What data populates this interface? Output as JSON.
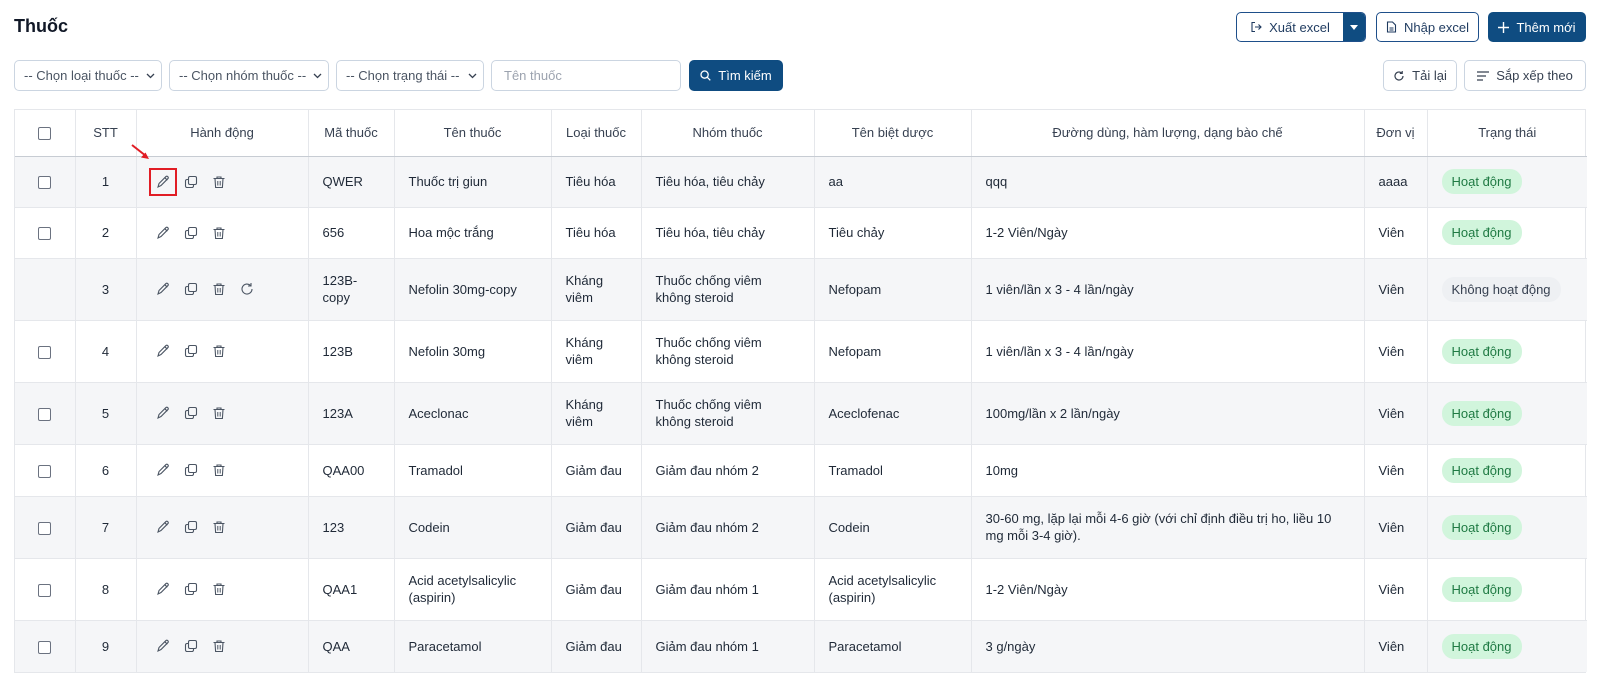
{
  "page": {
    "title": "Thuốc"
  },
  "toolbar": {
    "export_label": "Xuất excel",
    "import_label": "Nhập excel",
    "add_label": "Thêm mới",
    "reload_label": "Tải lại",
    "sort_label": "Sắp xếp theo"
  },
  "filters": {
    "drug_type": "-- Chọn loại thuốc --",
    "drug_group": "-- Chọn nhóm thuốc --",
    "status": "-- Chọn trạng thái --",
    "name_placeholder": "Tên thuốc",
    "search_label": "Tìm kiếm"
  },
  "table": {
    "headers": [
      "STT",
      "Hành động",
      "Mã thuốc",
      "Tên thuốc",
      "Loại thuốc",
      "Nhóm thuốc",
      "Tên biệt dược",
      "Đường dùng, hàm lượng, dạng bào chế",
      "Đơn vị",
      "Trạng thái"
    ],
    "rows": [
      {
        "stt": "1",
        "code": "QWER",
        "name": "Thuốc trị giun",
        "type": "Tiêu hóa",
        "group": "Tiêu hóa, tiêu chảy",
        "brand": "aa",
        "usage": "qqq",
        "unit": "aaaa",
        "status": "Hoạt động"
      },
      {
        "stt": "2",
        "code": "656",
        "name": "Hoa mộc trắng",
        "type": "Tiêu hóa",
        "group": "Tiêu hóa, tiêu chảy",
        "brand": "Tiêu chảy",
        "usage": "1-2 Viên/Ngày",
        "unit": "Viên",
        "status": "Hoạt động"
      },
      {
        "stt": "3",
        "code": "123B-copy",
        "name": "Nefolin 30mg-copy",
        "type": "Kháng viêm",
        "group": "Thuốc chống viêm không steroid",
        "brand": "Nefopam",
        "usage": "1 viên/lần x 3 - 4 lần/ngày",
        "unit": "Viên",
        "status": "Không hoạt động"
      },
      {
        "stt": "4",
        "code": "123B",
        "name": "Nefolin 30mg",
        "type": "Kháng viêm",
        "group": "Thuốc chống viêm không steroid",
        "brand": "Nefopam",
        "usage": "1 viên/lần x 3 - 4 lần/ngày",
        "unit": "Viên",
        "status": "Hoạt động"
      },
      {
        "stt": "5",
        "code": "123A",
        "name": "Aceclonac",
        "type": "Kháng viêm",
        "group": "Thuốc chống viêm không steroid",
        "brand": "Aceclofenac",
        "usage": "100mg/lần x 2 lần/ngày",
        "unit": "Viên",
        "status": "Hoạt động"
      },
      {
        "stt": "6",
        "code": "QAA00",
        "name": "Tramadol",
        "type": "Giảm đau",
        "group": "Giảm đau nhóm 2",
        "brand": "Tramadol",
        "usage": "10mg",
        "unit": "Viên",
        "status": "Hoạt động"
      },
      {
        "stt": "7",
        "code": "123",
        "name": "Codein",
        "type": "Giảm đau",
        "group": "Giảm đau nhóm 2",
        "brand": "Codein",
        "usage": "30-60 mg, lặp lại mỗi 4-6 giờ (với chỉ định điều trị ho, liều 10 mg mỗi 3-4 giờ).",
        "unit": "Viên",
        "status": "Hoạt động"
      },
      {
        "stt": "8",
        "code": "QAA1",
        "name": "Acid acetylsalicylic (aspirin)",
        "type": "Giảm đau",
        "group": "Giảm đau nhóm 1",
        "brand": "Acid acetylsalicylic (aspirin)",
        "usage": "1-2 Viên/Ngày",
        "unit": "Viên",
        "status": "Hoạt động"
      },
      {
        "stt": "9",
        "code": "QAA",
        "name": "Paracetamol",
        "type": "Giảm đau",
        "group": "Giảm đau nhóm 1",
        "brand": "Paracetamol",
        "usage": "3 g/ngày",
        "unit": "Viên",
        "status": "Hoạt động"
      }
    ]
  },
  "colors": {
    "primary": "#0f4c81",
    "active_badge_bg": "#d1f5dc",
    "active_badge_text": "#1f7a43",
    "highlight": "#e11d25"
  }
}
